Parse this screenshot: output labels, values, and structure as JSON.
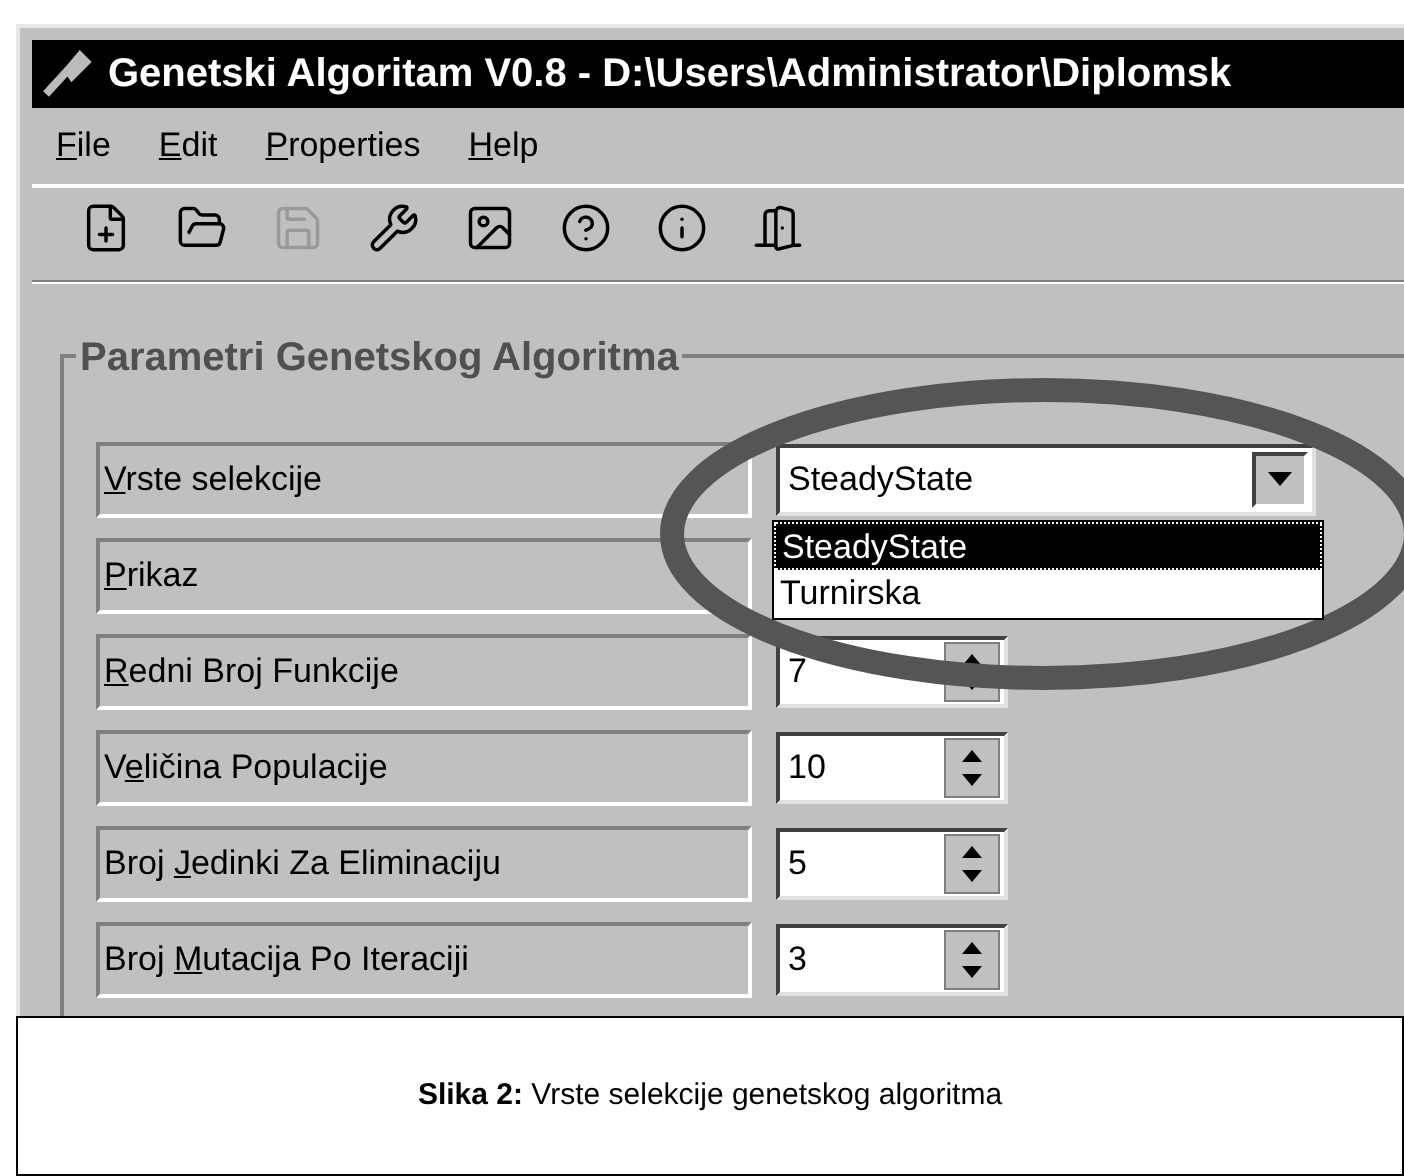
{
  "window": {
    "title": "Genetski Algoritam V0.8 - D:\\Users\\Administrator\\Diplomsk"
  },
  "menu": [
    {
      "key": "F",
      "post": "ile"
    },
    {
      "key": "E",
      "post": "dit"
    },
    {
      "key": "P",
      "post": "roperties"
    },
    {
      "key": "H",
      "post": "elp"
    }
  ],
  "toolbar": [
    {
      "kind": "new",
      "disabled": false
    },
    {
      "kind": "open",
      "disabled": false
    },
    {
      "kind": "save",
      "disabled": true
    },
    {
      "kind": "tools",
      "disabled": false
    },
    {
      "kind": "image",
      "disabled": false
    },
    {
      "kind": "help",
      "disabled": false
    },
    {
      "kind": "info",
      "disabled": false
    },
    {
      "kind": "exit",
      "disabled": false
    }
  ],
  "group": {
    "title": "Parametri Genetskog Algoritma",
    "rows": [
      {
        "kind": "combo",
        "label": {
          "key": "V",
          "post": "rste selekcije"
        },
        "value": "SteadyState",
        "expanded": true,
        "options": [
          {
            "text": "SteadyState",
            "selected": true
          },
          {
            "text": "Turnirska",
            "selected": false
          }
        ]
      },
      {
        "kind": "empty",
        "label": {
          "key": "P",
          "post": "rikaz"
        }
      },
      {
        "kind": "spin",
        "label": {
          "key": "R",
          "post": "edni Broj Funkcije"
        },
        "value": "7"
      },
      {
        "kind": "spin",
        "label": {
          "pre": "V",
          "key": "e",
          "post": "ličina Populacije"
        },
        "value": "10"
      },
      {
        "kind": "spin",
        "label": {
          "pre": "Broj ",
          "key": "J",
          "post": "edinki Za Eliminaciju"
        },
        "value": "5"
      },
      {
        "kind": "spin",
        "label": {
          "pre": "Broj ",
          "key": "M",
          "post": "utacija Po Iteraciji"
        },
        "value": "3"
      }
    ]
  },
  "caption": "**Slika 2:** Vrste selekcije genetskog algoritma"
}
